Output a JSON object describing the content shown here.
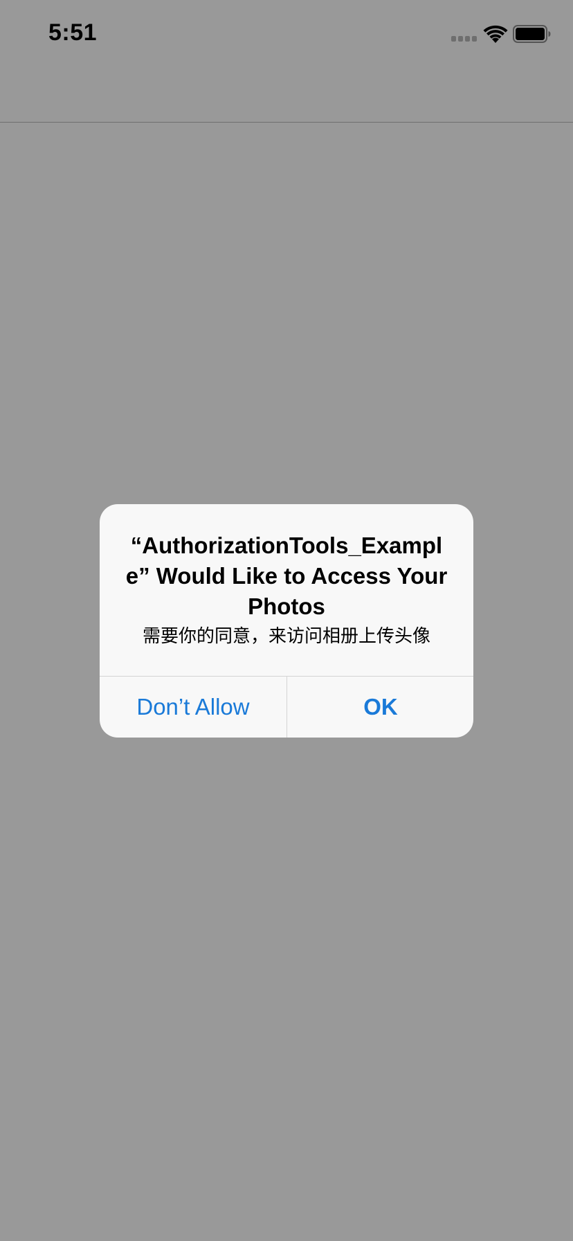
{
  "status_bar": {
    "time": "5:51",
    "icons": [
      "signal-icon",
      "wifi-icon",
      "battery-icon"
    ]
  },
  "alert": {
    "title": "“AuthorizationTools_Example” Would Like to Access Your Photos",
    "message": "需要你的同意，来访问相册上传头像",
    "buttons": {
      "dont_allow": "Don’t Allow",
      "ok": "OK"
    }
  },
  "colors": {
    "background": "#999999",
    "alert_background": "#f8f8f8",
    "button_tint": "#1a7ad8",
    "divider": "#d4d4d4"
  }
}
